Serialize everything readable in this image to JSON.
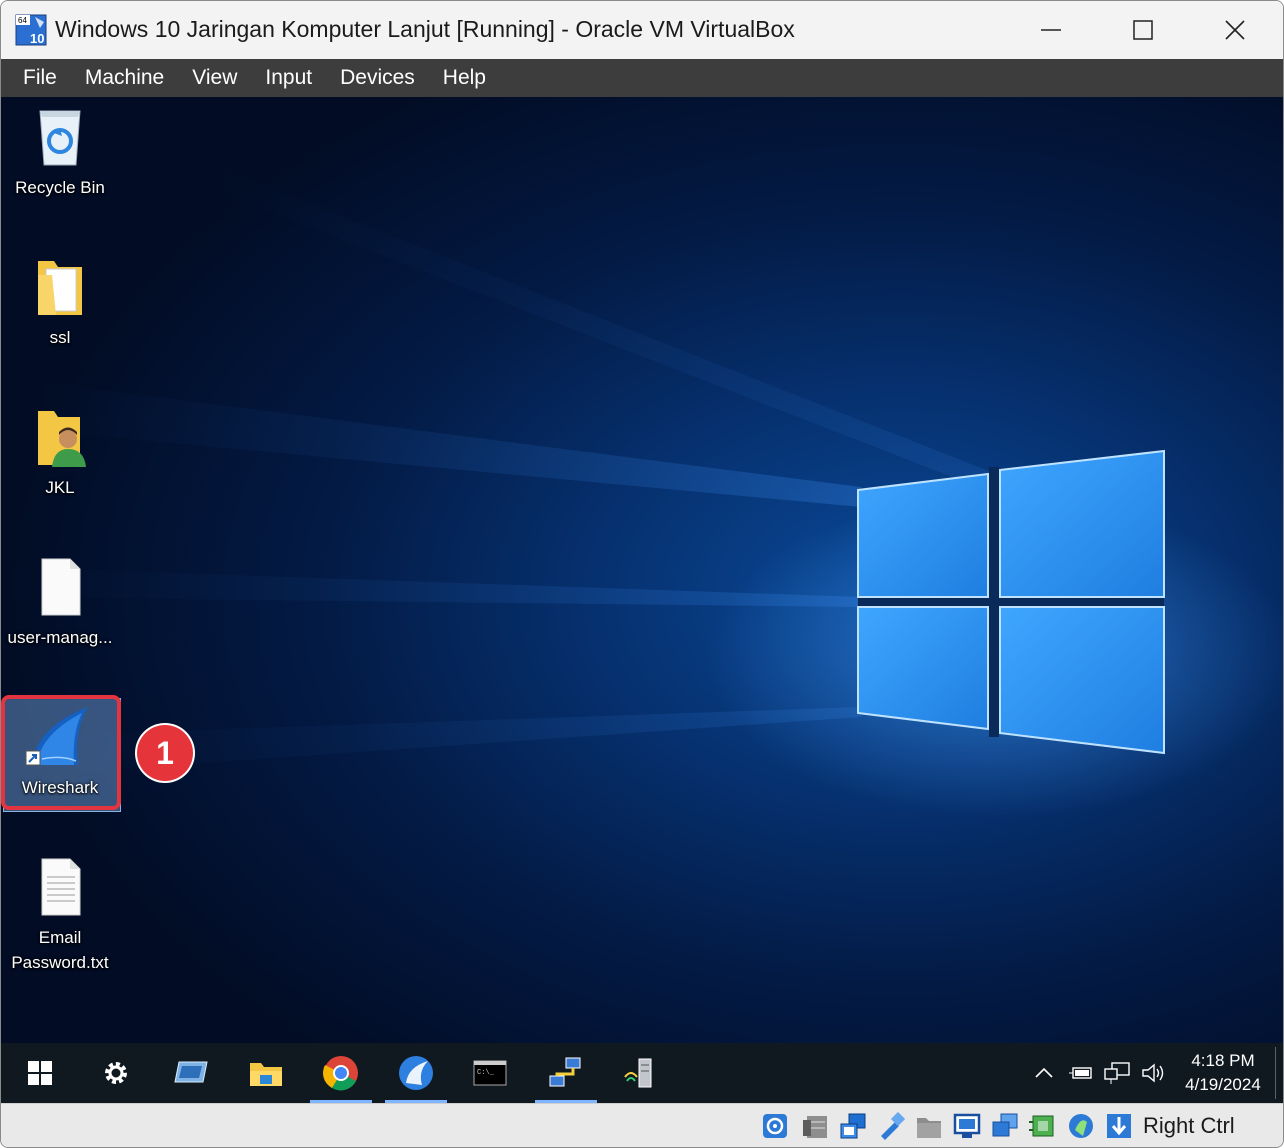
{
  "window": {
    "title": "Windows 10 Jaringan Komputer Lanjut [Running] - Oracle VM VirtualBox",
    "icon_badge_top": "64",
    "icon_badge_bottom": "10"
  },
  "menubar": {
    "items": [
      "File",
      "Machine",
      "View",
      "Input",
      "Devices",
      "Help"
    ]
  },
  "desktop": {
    "icons": [
      {
        "label": "Recycle Bin",
        "icon": "recycle-bin-icon"
      },
      {
        "label": "ssl",
        "icon": "folder-icon"
      },
      {
        "label": "JKL",
        "icon": "user-folder-icon"
      },
      {
        "label": "user-manag...",
        "icon": "document-icon"
      },
      {
        "label": "Wireshark",
        "icon": "wireshark-icon"
      },
      {
        "label": "Email\nPassword.txt",
        "icon": "text-file-icon"
      }
    ],
    "annotation_number": "1"
  },
  "taskbar": {
    "items": [
      "start-icon",
      "settings-icon",
      "remote-desktop-icon",
      "file-explorer-icon",
      "chrome-icon",
      "wireshark-icon",
      "cmd-icon",
      "network-icon",
      "server-icon"
    ],
    "clock_time": "4:18 PM",
    "clock_date": "4/19/2024"
  },
  "statusbar": {
    "host_key": "Right Ctrl"
  },
  "colors": {
    "menubar_bg": "#3d3d3d",
    "annotation_red": "#e3343f",
    "taskbar_bg": "#101820"
  }
}
